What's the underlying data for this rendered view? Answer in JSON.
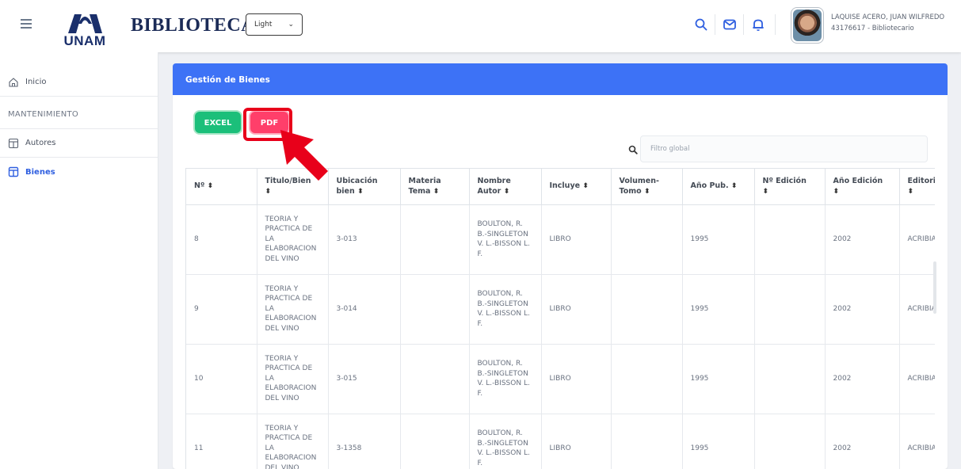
{
  "header": {
    "logo_text": "UNAM",
    "app_title": "BIBLIOTECA",
    "theme_select": {
      "value": "Light",
      "options": [
        "Light"
      ]
    },
    "user_name": "LAQUISE ACERO, JUAN WILFREDO",
    "user_role": "43176617 - Bibliotecario"
  },
  "sidebar": {
    "items": [
      {
        "label": "Inicio",
        "icon": "home-icon",
        "active": false
      },
      {
        "label": "MANTENIMIENTO",
        "section": true
      },
      {
        "label": "Autores",
        "icon": "table-icon",
        "active": false
      },
      {
        "label": "Bienes",
        "icon": "table-icon",
        "active": true
      }
    ]
  },
  "main": {
    "card_title": "Gestión de Bienes",
    "excel_label": "EXCEL",
    "pdf_label": "PDF",
    "search_placeholder": "Filtro global",
    "columns": [
      {
        "l1": "Nº",
        "l2": ""
      },
      {
        "l1": "Titulo/Bien",
        "l2": ""
      },
      {
        "l1": "Ubicación",
        "l2": "bien"
      },
      {
        "l1": "Materia",
        "l2": "Tema"
      },
      {
        "l1": "Nombre",
        "l2": "Autor"
      },
      {
        "l1": "Incluye",
        "l2": ""
      },
      {
        "l1": "Volumen-",
        "l2": "Tomo"
      },
      {
        "l1": "Año Pub.",
        "l2": ""
      },
      {
        "l1": "Nº Edición",
        "l2": ""
      },
      {
        "l1": "Año Edición",
        "l2": ""
      },
      {
        "l1": "Editorial",
        "l2": ""
      }
    ],
    "rows": [
      {
        "n": "8",
        "titulo": "TEORIA Y PRACTICA DE LA ELABORACION DEL VINO",
        "ubicacion": "3-013",
        "materia": "",
        "autor": "BOULTON, R. B.-SINGLETON V. L.-BISSON L. F.",
        "incluye": "LIBRO",
        "volumen": "",
        "anio_pub": "1995",
        "edicion": "",
        "anio_edicion": "2002",
        "editorial": "ACRIBIA"
      },
      {
        "n": "9",
        "titulo": "TEORIA Y PRACTICA DE LA ELABORACION DEL VINO",
        "ubicacion": "3-014",
        "materia": "",
        "autor": "BOULTON, R. B.-SINGLETON V. L.-BISSON L. F.",
        "incluye": "LIBRO",
        "volumen": "",
        "anio_pub": "1995",
        "edicion": "",
        "anio_edicion": "2002",
        "editorial": "ACRIBIA"
      },
      {
        "n": "10",
        "titulo": "TEORIA Y PRACTICA DE LA ELABORACION DEL VINO",
        "ubicacion": "3-015",
        "materia": "",
        "autor": "BOULTON, R. B.-SINGLETON V. L.-BISSON L. F.",
        "incluye": "LIBRO",
        "volumen": "",
        "anio_pub": "1995",
        "edicion": "",
        "anio_edicion": "2002",
        "editorial": "ACRIBIA"
      },
      {
        "n": "11",
        "titulo": "TEORIA Y PRACTICA DE LA ELABORACION DEL VINO",
        "ubicacion": "3-1358",
        "materia": "",
        "autor": "BOULTON, R. B.-SINGLETON V. L.-BISSON L. F.",
        "incluye": "LIBRO",
        "volumen": "",
        "anio_pub": "1995",
        "edicion": "",
        "anio_edicion": "2002",
        "editorial": "ACRIBIA"
      }
    ]
  },
  "colors": {
    "accent": "#3d72f6",
    "excel": "#1bbf7a",
    "pdf": "#ff3f6a",
    "annotation": "#e8001a"
  }
}
